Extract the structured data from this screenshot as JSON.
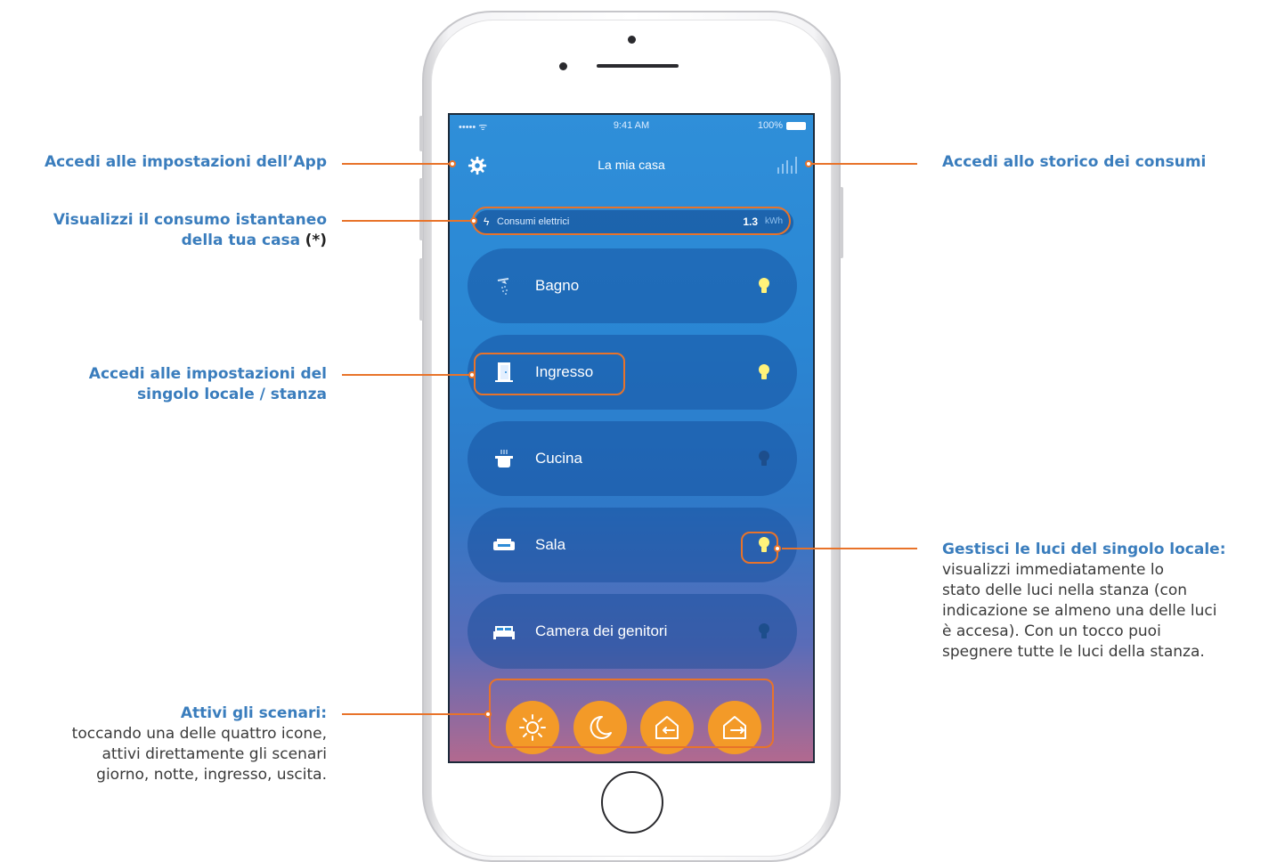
{
  "annotations": {
    "settings": {
      "title": "Accedi alle impostazioni dell’App"
    },
    "history": {
      "title": "Accedi allo storico dei consumi"
    },
    "consumption": {
      "title_line1": "Visualizzi il consumo istantaneo",
      "title_line2": "della tua casa",
      "asterisk": "(*)"
    },
    "room_settings": {
      "title_line1": "Accedi alle impostazioni del",
      "title_line2": "singolo locale / stanza"
    },
    "lights": {
      "title": "Gestisci le luci del singolo locale:",
      "desc_line1": "visualizzi immediatamente lo",
      "desc_line2": "stato delle luci nella stanza (con",
      "desc_line3": "indicazione se almeno una delle luci",
      "desc_line4": "è accesa). Con un tocco puoi",
      "desc_line5": "spegnere tutte le luci della stanza."
    },
    "scenarios": {
      "title": "Attivi gli scenari:",
      "desc_line1": "toccando una delle quattro icone,",
      "desc_line2": "attivi direttamente gli scenari",
      "desc_line3": "giorno, notte, ingresso, uscita."
    }
  },
  "status_bar": {
    "signal": "••••• ᯤ",
    "time": "9:41 AM",
    "battery": "100%"
  },
  "header": {
    "title": "La mia casa",
    "settings_icon": "gear-icon",
    "history_icon": "bar-chart-icon"
  },
  "consumption_bar": {
    "label": "Consumi elettrici",
    "value": "1.3",
    "unit": "kWh"
  },
  "rooms": [
    {
      "name": "Bagno",
      "icon": "shower-icon",
      "light_on": true
    },
    {
      "name": "Ingresso",
      "icon": "door-icon",
      "light_on": true
    },
    {
      "name": "Cucina",
      "icon": "pot-icon",
      "light_on": false
    },
    {
      "name": "Sala",
      "icon": "sofa-icon",
      "light_on": true
    },
    {
      "name": "Camera dei genitori",
      "icon": "bed-icon",
      "light_on": false
    }
  ],
  "scenarios": [
    {
      "name": "giorno",
      "icon": "sun-icon"
    },
    {
      "name": "notte",
      "icon": "moon-icon"
    },
    {
      "name": "ingresso",
      "icon": "house-enter-icon"
    },
    {
      "name": "uscita",
      "icon": "house-exit-icon"
    }
  ],
  "colors": {
    "accent": "#e8732a",
    "annotation_title": "#3a7dbd",
    "scenario_button": "#f39a28",
    "bulb_on": "#fff27a",
    "bulb_off": "#1d4e8c"
  }
}
